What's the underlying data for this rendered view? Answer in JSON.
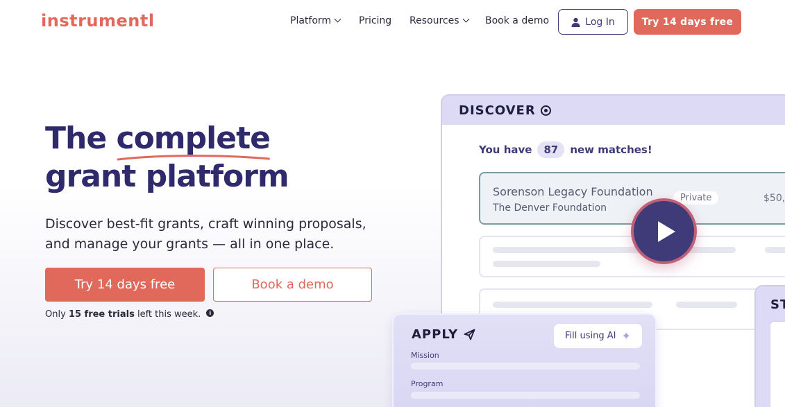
{
  "header": {
    "logo": "instrumentl",
    "nav": [
      {
        "label": "Platform",
        "dropdown": true
      },
      {
        "label": "Pricing",
        "dropdown": false
      },
      {
        "label": "Resources",
        "dropdown": true
      },
      {
        "label": "Book a demo",
        "dropdown": false
      }
    ],
    "login_label": "Log In",
    "trial_label": "Try 14 days free"
  },
  "hero": {
    "title_before": "The ",
    "title_highlight": "complete",
    "title_after": "grant platform",
    "subtitle": "Discover best-fit grants, craft winning proposals, and manage your grants — all in one place.",
    "cta_primary": "Try 14 days free",
    "cta_secondary": "Book a demo",
    "note_prefix": "Only ",
    "note_bold": "15 free trials",
    "note_suffix": " left this week.",
    "note_icon": "i"
  },
  "discover": {
    "title": "DISCOVER",
    "matches_prefix": "You have",
    "matches_count": "87",
    "matches_suffix": "new matches!",
    "grant": {
      "name": "Sorenson Legacy Foundation",
      "org": "The Denver Foundation",
      "badge": "Private",
      "amount": "$50,0"
    }
  },
  "apply": {
    "title": "APPLY",
    "ai_button": "Fill using AI",
    "field1": "Mission",
    "field2": "Program"
  },
  "status": {
    "title": "ST"
  },
  "colors": {
    "brand": "#e0695c",
    "navy": "#2e2a6b",
    "lavender": "#dcdaf4"
  },
  "icons": [
    "chevron-down-icon",
    "user-icon",
    "info-icon",
    "target-icon",
    "play-icon",
    "send-icon",
    "sparkle-icon"
  ]
}
